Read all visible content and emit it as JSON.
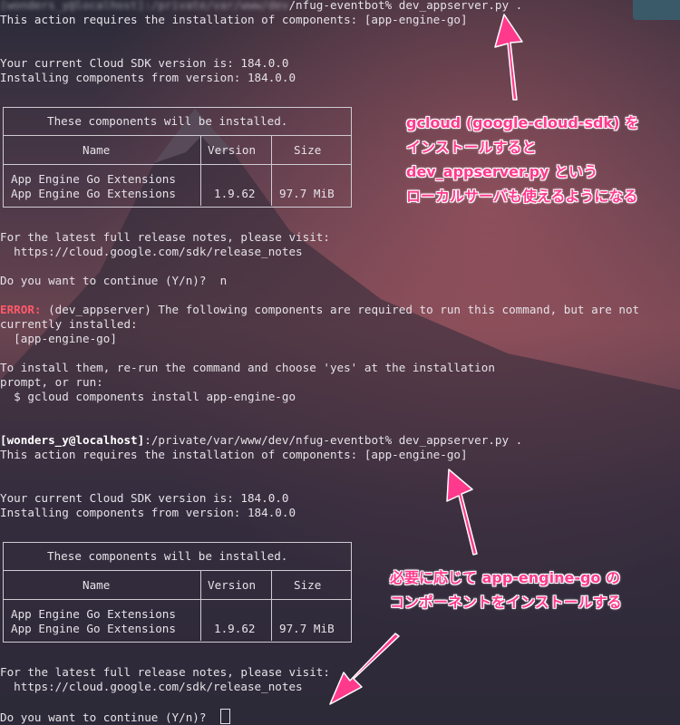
{
  "terminal": {
    "blurred_path_prefix": "[wonders_y@localhost]:/private/var/www/dev",
    "line_cmd_tail": "/nfug-eventbot% dev_appserver.py .",
    "requires": "This action requires the installation of components: [app-engine-go]",
    "sdk_version": "Your current Cloud SDK version is: 184.0.0",
    "installing_from": "Installing components from version: 184.0.0",
    "release_notes_1": "For the latest full release notes, please visit:",
    "release_notes_url": "  https://cloud.google.com/sdk/release_notes",
    "continue_prompt_answered": "Do you want to continue (Y/n)?  n",
    "error_label": "ERROR:",
    "error_msg": " (dev_appserver) The following components are required to run this command, but are not",
    "error_msg_2": "currently installed:",
    "error_component": "  [app-engine-go]",
    "install_hint_1": "To install them, re-run the command and choose 'yes' at the installation",
    "install_hint_2": "prompt, or run:",
    "install_hint_3": "  $ gcloud components install app-engine-go",
    "prompt_user": "[wonders_y@localhost]",
    "prompt_path_cmd": ":/private/var/www/dev/nfug-eventbot% dev_appserver.py .",
    "continue_prompt_open": "Do you want to continue (Y/n)?  "
  },
  "table": {
    "title": "These components will be installed.",
    "col_name": "Name",
    "col_version": "Version",
    "col_size": "Size",
    "row_1_name": "App Engine Go Extensions",
    "row_2_name": "App Engine Go Extensions",
    "row_2_version": "1.9.62",
    "row_2_size": "97.7 MiB"
  },
  "annotations": {
    "top_1": "gcloud (google-cloud-sdk) を",
    "top_2": "インストールすると",
    "top_3": "dev_appserver.py という",
    "top_4": "ローカルサーバも使えるようになる",
    "bottom_1": "必要に応じて app-engine-go の",
    "bottom_2": "コンポーネントをインストールする"
  },
  "colors": {
    "annotation": "#ff3a8c",
    "error": "#ff5a6a",
    "text": "#e6e2e8"
  },
  "icons": {
    "arrow": "pink-arrow"
  }
}
